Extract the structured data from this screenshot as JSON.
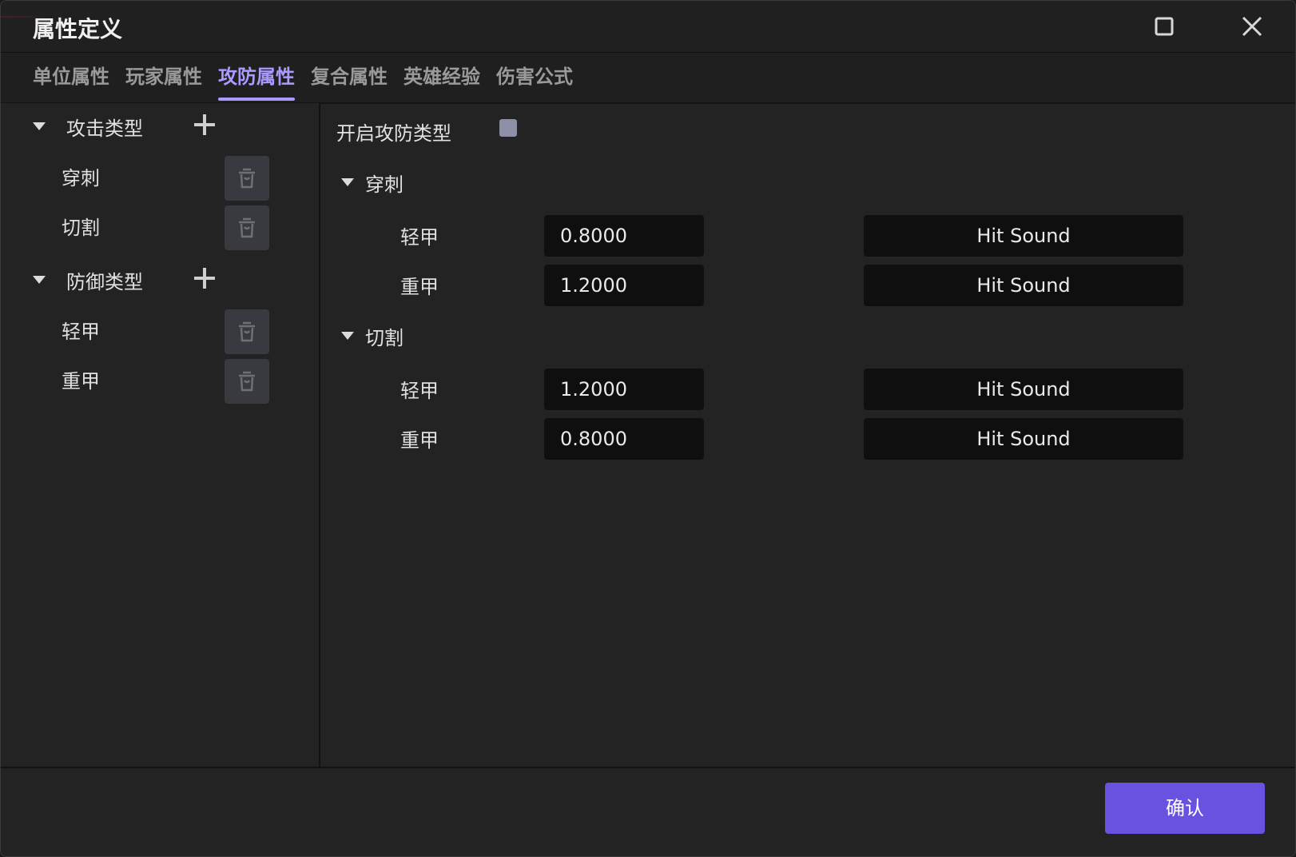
{
  "window": {
    "title": "属性定义",
    "maximize_icon": "maximize-icon",
    "close_icon": "close-icon"
  },
  "tabs": [
    {
      "label": "单位属性"
    },
    {
      "label": "玩家属性"
    },
    {
      "label": "攻防属性",
      "active": true
    },
    {
      "label": "复合属性"
    },
    {
      "label": "英雄经验"
    },
    {
      "label": "伤害公式"
    }
  ],
  "sidebar": {
    "attack_group": {
      "label": "攻击类型",
      "items": [
        {
          "label": "穿刺"
        },
        {
          "label": "切割"
        }
      ]
    },
    "defense_group": {
      "label": "防御类型",
      "items": [
        {
          "label": "轻甲"
        },
        {
          "label": "重甲"
        }
      ]
    }
  },
  "main": {
    "enable_label": "开启攻防类型",
    "enable_checked": false,
    "sections": [
      {
        "label": "穿刺",
        "rows": [
          {
            "label": "轻甲",
            "value": "0.8000",
            "sound": "Hit Sound"
          },
          {
            "label": "重甲",
            "value": "1.2000",
            "sound": "Hit Sound"
          }
        ]
      },
      {
        "label": "切割",
        "rows": [
          {
            "label": "轻甲",
            "value": "1.2000",
            "sound": "Hit Sound"
          },
          {
            "label": "重甲",
            "value": "0.8000",
            "sound": "Hit Sound"
          }
        ]
      }
    ]
  },
  "footer": {
    "confirm_label": "确认"
  },
  "colors": {
    "accent": "#6a52e0",
    "tab_active": "#a99bff"
  }
}
